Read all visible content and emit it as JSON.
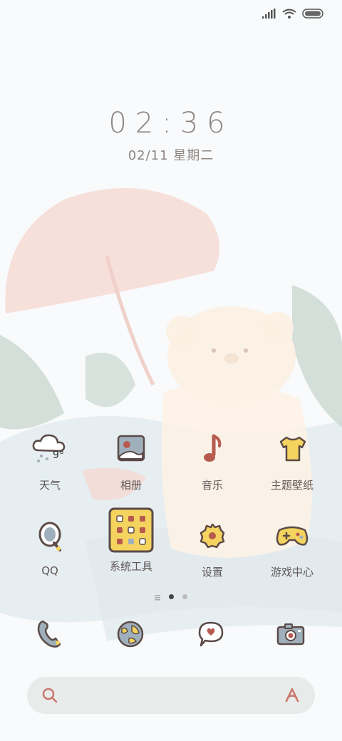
{
  "lockscreen": {
    "time": "02:36",
    "date": "02/11 星期二"
  },
  "status": {
    "signal_icon": "signal-icon",
    "wifi_icon": "wifi-icon",
    "battery_icon": "battery-icon"
  },
  "apps": [
    {
      "label": "天气",
      "icon": "weather-cloud-icon",
      "temp": "9°"
    },
    {
      "label": "相册",
      "icon": "photo-album-icon"
    },
    {
      "label": "音乐",
      "icon": "music-note-icon"
    },
    {
      "label": "主题壁纸",
      "icon": "tshirt-icon"
    },
    {
      "label": "QQ",
      "icon": "qq-icon"
    },
    {
      "label": "系统工具",
      "icon": "system-tools-folder-icon"
    },
    {
      "label": "设置",
      "icon": "gear-icon"
    },
    {
      "label": "游戏中心",
      "icon": "gamepad-icon"
    }
  ],
  "page_indicator": {
    "pages": 3,
    "active": 1
  },
  "dock": [
    {
      "icon": "phone-icon"
    },
    {
      "icon": "globe-icon"
    },
    {
      "icon": "message-bubble-icon"
    },
    {
      "icon": "camera-icon"
    }
  ],
  "search": {
    "search_icon": "search-icon",
    "assistant_icon": "assistant-icon"
  },
  "colors": {
    "accent_yellow": "#f4d35e",
    "accent_red": "#b65a4f",
    "outline": "#5b4a47",
    "blue_grey": "#9fb0bc"
  }
}
